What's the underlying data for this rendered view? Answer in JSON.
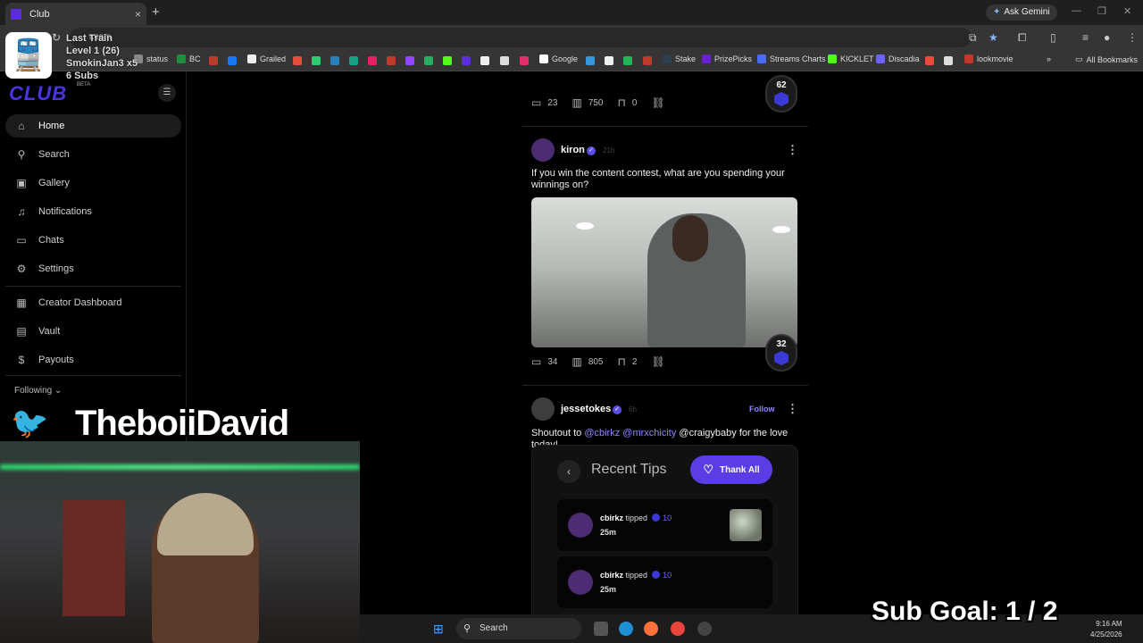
{
  "browser": {
    "tab_title": "Club",
    "new_tab": "+",
    "tab_close": "×",
    "ask_gemini": "Ask Gemini",
    "url_partial": "r.com",
    "all_bookmarks": "All Bookmarks",
    "bookmarks": [
      {
        "label": "status",
        "color": "#888888"
      },
      {
        "label": "BC",
        "color": "#1e8f3e"
      },
      {
        "label": "Grailed",
        "color": "#eeeeee"
      },
      {
        "label": "Google",
        "color": "#ffffff"
      },
      {
        "label": "Stake",
        "color": "#2c3e50"
      },
      {
        "label": "PrizePicks",
        "color": "#6a1fd1"
      },
      {
        "label": "Streams Charts",
        "color": "#4a6cf7"
      },
      {
        "label": "KICKLET",
        "color": "#53fc18"
      },
      {
        "label": "Discadia",
        "color": "#6c63ff"
      },
      {
        "label": "lookmovie",
        "color": "#c0392b"
      }
    ]
  },
  "sidebar": {
    "brand": "CLUB",
    "beta": "BETA",
    "items": [
      {
        "label": "Home",
        "icon": "home-icon",
        "glyph": "⌂"
      },
      {
        "label": "Search",
        "icon": "search-icon",
        "glyph": "⚲"
      },
      {
        "label": "Gallery",
        "icon": "gallery-icon",
        "glyph": "▣"
      },
      {
        "label": "Notifications",
        "icon": "bell-icon",
        "glyph": "♫"
      },
      {
        "label": "Chats",
        "icon": "chat-icon",
        "glyph": "▭"
      },
      {
        "label": "Settings",
        "icon": "gear-icon",
        "glyph": "⚙"
      },
      {
        "label": "Creator Dashboard",
        "icon": "dashboard-icon",
        "glyph": "▦"
      },
      {
        "label": "Vault",
        "icon": "vault-icon",
        "glyph": "▤"
      },
      {
        "label": "Payouts",
        "icon": "payouts-icon",
        "glyph": "$"
      }
    ],
    "following_label": "Following"
  },
  "overlay": {
    "last_train": "Last Train",
    "level": "Level 1 (26)",
    "smoki": "SmokinJan3 x5",
    "subs": "6 Subs",
    "streamer": "TheboiiDavid",
    "sub_goal": "Sub Goal:  1 / 2"
  },
  "feed": {
    "post0": {
      "comments": "23",
      "views": "750",
      "bookmarks": "0",
      "score": "62"
    },
    "post1": {
      "username": "kiron",
      "time": "21h",
      "text": "If you win the content contest, what are you spending your winnings on?",
      "comments": "34",
      "views": "805",
      "bookmarks": "2",
      "score": "32"
    },
    "post2": {
      "username": "jessetokes",
      "time": "6h",
      "follow": "Follow",
      "text_prefix": "Shoutout to ",
      "mention1": "@cbirkz",
      "mention2": "@mrxchicity",
      "text_suffix": " @craigybaby for the love today!",
      "tipcard": {
        "title": "Recent Tips",
        "button": "Thank All",
        "tips": [
          {
            "user": "cbirkz",
            "action": "tipped",
            "amount": "10",
            "time": "25m"
          },
          {
            "user": "cbirkz",
            "action": "tipped",
            "amount": "10",
            "time": "25m"
          }
        ]
      }
    }
  },
  "taskbar": {
    "search": "Search",
    "time": "9:16 AM",
    "date": "4/25/2026"
  }
}
